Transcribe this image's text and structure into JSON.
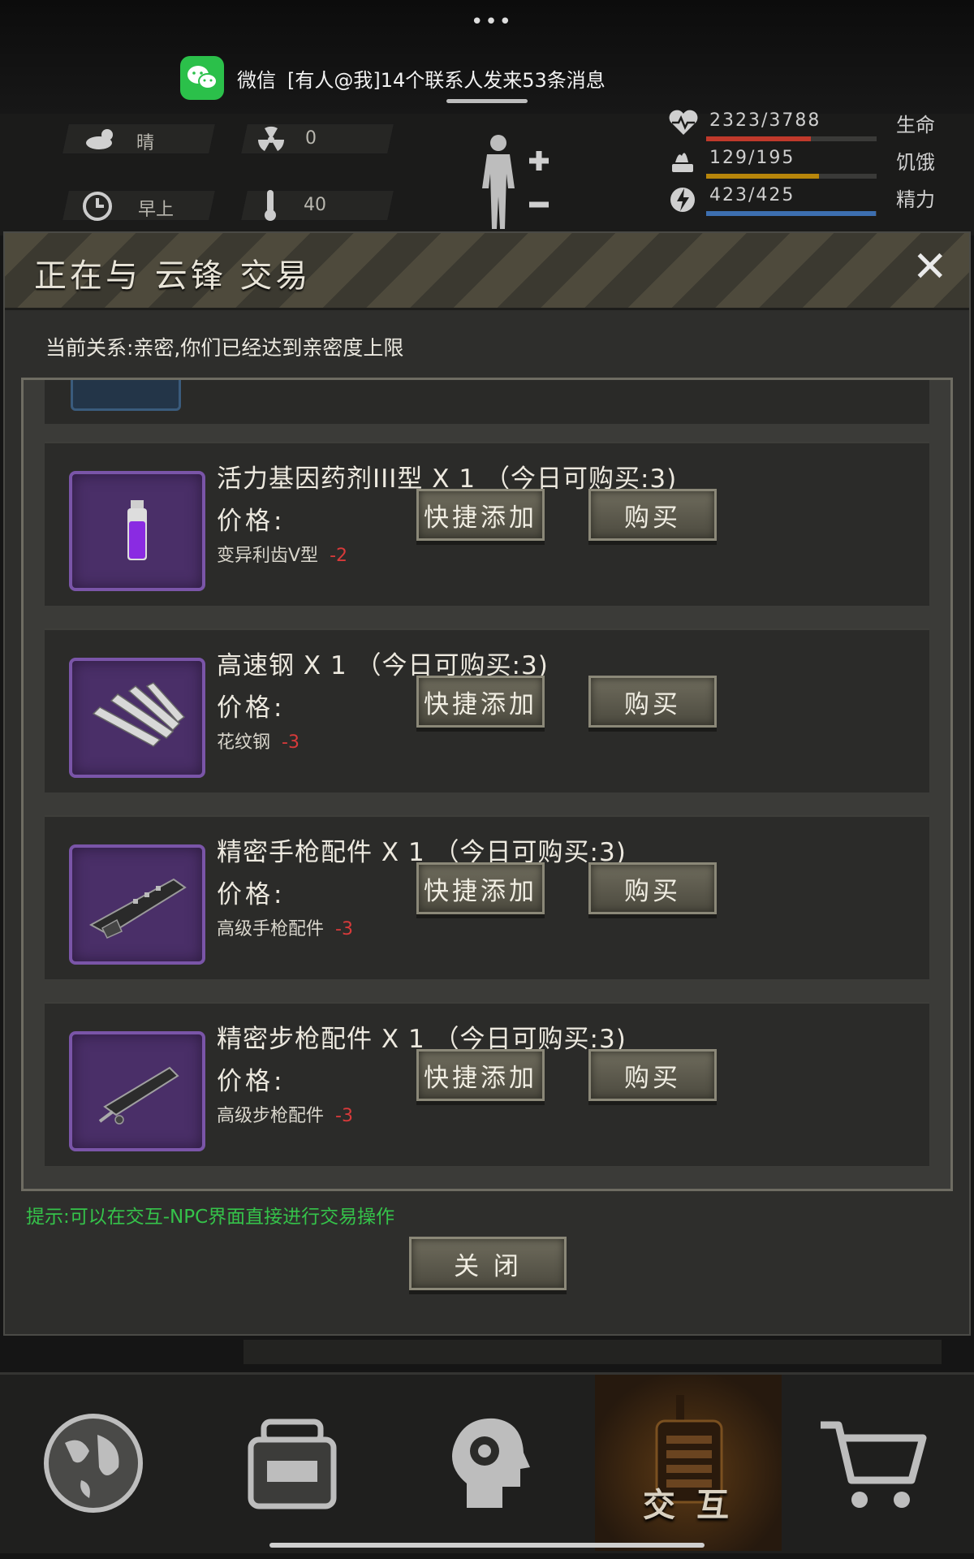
{
  "system": {
    "more_dots": "•••",
    "notification": {
      "app": "微信",
      "message": "[有人@我]14个联系人发来53条消息",
      "icon": "wechat-icon"
    }
  },
  "status": {
    "weather": "晴",
    "radiation": "0",
    "time_of_day": "早上",
    "temperature": "40",
    "stats": [
      {
        "value": "2323/3788",
        "label": "生命",
        "fraction": 0.613,
        "color": "#c0392b",
        "icon": "heart-icon"
      },
      {
        "value": "129/195",
        "label": "饥饿",
        "fraction": 0.662,
        "color": "#b8860b",
        "icon": "food-icon"
      },
      {
        "value": "423/425",
        "label": "精力",
        "fraction": 0.995,
        "color": "#3d6fb0",
        "icon": "energy-icon"
      }
    ]
  },
  "dialog": {
    "title": "正在与 云锋 交易",
    "relation": "当前关系:亲密,你们已经达到亲密度上限",
    "items": [
      {
        "name": "活力基因药剂III型 X 1 （今日可购买:3)",
        "price_label": "价格:",
        "cost_item": "变异利齿V型",
        "cost_qty": "-2",
        "quick_label": "快捷添加",
        "buy_label": "购买",
        "icon": "vial-icon"
      },
      {
        "name": "高速钢 X 1 （今日可购买:3)",
        "price_label": "价格:",
        "cost_item": "花纹钢",
        "cost_qty": "-3",
        "quick_label": "快捷添加",
        "buy_label": "购买",
        "icon": "steel-bars-icon"
      },
      {
        "name": "精密手枪配件 X 1 （今日可购买:3)",
        "price_label": "价格:",
        "cost_item": "高级手枪配件",
        "cost_qty": "-3",
        "quick_label": "快捷添加",
        "buy_label": "购买",
        "icon": "pistol-part-icon"
      },
      {
        "name": "精密步枪配件 X 1 （今日可购买:3)",
        "price_label": "价格:",
        "cost_item": "高级步枪配件",
        "cost_qty": "-3",
        "quick_label": "快捷添加",
        "buy_label": "购买",
        "icon": "rifle-part-icon"
      }
    ],
    "hint": "提示:可以在交互-NPC界面直接进行交易操作",
    "close_label": "关 闭"
  },
  "bottom_tabs": [
    {
      "icon": "globe-icon",
      "label": ""
    },
    {
      "icon": "backpack-icon",
      "label": ""
    },
    {
      "icon": "head-gear-icon",
      "label": ""
    },
    {
      "icon": "radio-icon",
      "label": "交 互",
      "active": true
    },
    {
      "icon": "cart-icon",
      "label": ""
    }
  ]
}
